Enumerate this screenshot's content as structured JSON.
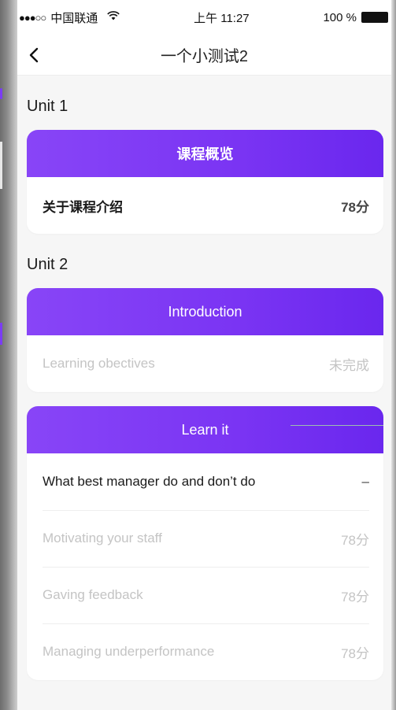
{
  "status_bar": {
    "signal": "●●●○○",
    "carrier": "中国联通",
    "wifi_icon": "wifi-icon",
    "time": "上午 11:27",
    "battery": "100 %"
  },
  "nav": {
    "title": "一个小测试2",
    "back_icon": "chevron-left-icon"
  },
  "units": [
    {
      "title": "Unit 1",
      "sections": [
        {
          "header": "课程概览",
          "items": [
            {
              "label": "关于课程介绍",
              "score": "78分",
              "state": "active"
            }
          ]
        }
      ]
    },
    {
      "title": "Unit 2",
      "sections": [
        {
          "header": "Introduction",
          "items": [
            {
              "label": "Learning obectives",
              "score": "未完成",
              "state": "muted"
            }
          ]
        },
        {
          "header": "Learn it",
          "items": [
            {
              "label": "What best manager do and don’t do",
              "score": "–",
              "state": "active"
            },
            {
              "label": "Motivating your staff",
              "score": "78分",
              "state": "muted"
            },
            {
              "label": "Gaving feedback",
              "score": "78分",
              "state": "muted"
            },
            {
              "label": "Managing underperformance",
              "score": "78分",
              "state": "muted"
            }
          ]
        }
      ]
    }
  ],
  "colors": {
    "accent": "#7a34f3",
    "muted_text": "#c4c4c4",
    "background": "#f6f6f6"
  }
}
